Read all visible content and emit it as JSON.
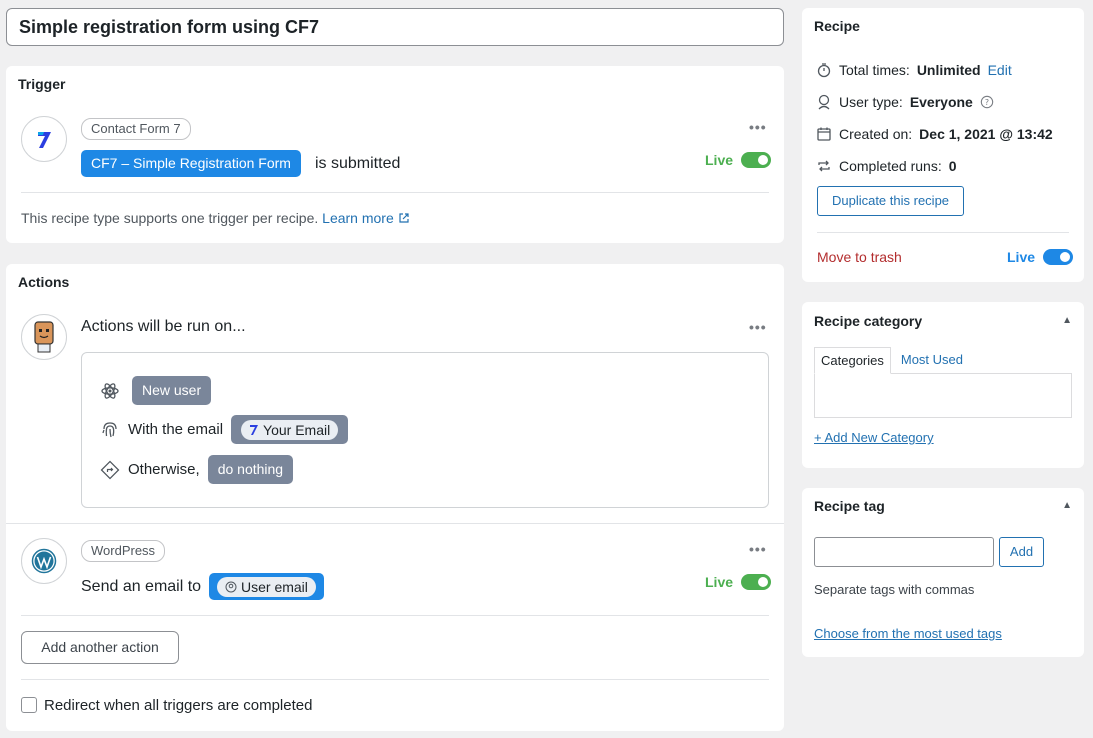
{
  "title": "Simple registration form using CF7",
  "trigger": {
    "heading": "Trigger",
    "integration": "Contact Form 7",
    "form_name": "CF7 – Simple Registration Form",
    "suffix": "is submitted",
    "status": "Live",
    "note": "This recipe type supports one trigger per recipe.",
    "learn_more": "Learn more"
  },
  "actions": {
    "heading": "Actions",
    "run_on_label": "Actions will be run on...",
    "new_user": "New user",
    "with_email_label": "With the email",
    "email_token": "Your Email",
    "otherwise_label": "Otherwise,",
    "otherwise_value": "do nothing",
    "action_integration": "WordPress",
    "send_email_label": "Send an email to",
    "user_email_token": "User email",
    "action_status": "Live",
    "add_action": "Add another action",
    "redirect_label": "Redirect when all triggers are completed"
  },
  "recipe": {
    "heading": "Recipe",
    "total_times_label": "Total times:",
    "total_times_value": "Unlimited",
    "edit": "Edit",
    "user_type_label": "User type:",
    "user_type_value": "Everyone",
    "created_label": "Created on:",
    "created_value": "Dec 1, 2021 @ 13:42",
    "completed_label": "Completed runs:",
    "completed_value": "0",
    "duplicate": "Duplicate this recipe",
    "trash": "Move to trash",
    "status": "Live"
  },
  "category": {
    "heading": "Recipe category",
    "tab_categories": "Categories",
    "tab_most_used": "Most Used",
    "add_new": "+ Add New Category"
  },
  "tag": {
    "heading": "Recipe tag",
    "add": "Add",
    "hint": "Separate tags with commas",
    "choose": "Choose from the most used tags"
  },
  "colors": {
    "accent": "#1e88e5",
    "live_green": "#4caf50",
    "trash_red": "#b32d2e",
    "token_slate": "#7a869a"
  }
}
